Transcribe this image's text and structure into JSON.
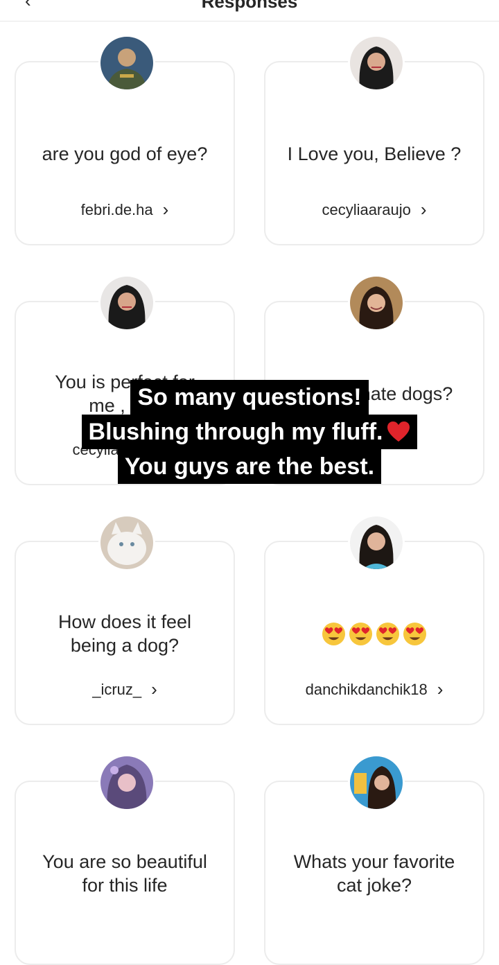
{
  "header": {
    "back_glyph": "‹",
    "title": "Responses"
  },
  "cards": [
    {
      "question": "are you god of eye?",
      "username": "febri.de.ha",
      "avatar": "man-in-uniform"
    },
    {
      "question": "I Love you, Believe ?",
      "username": "cecyliaaraujo",
      "avatar": "woman-dark-hair"
    },
    {
      "question": "You is perfect for\nme , i Lo",
      "username": "cecyliaaraujo",
      "avatar": "woman-dark-hair"
    },
    {
      "question": "Do you hate dogs?",
      "username": "",
      "avatar": "woman-smiling"
    },
    {
      "question": "How does it feel\nbeing a dog?",
      "username": "_icruz_",
      "avatar": "white-cat"
    },
    {
      "emoji": [
        "heart-eyes-emoji",
        "heart-eyes-emoji",
        "heart-eyes-emoji",
        "heart-eyes-emoji"
      ],
      "username": "danchikdanchik18",
      "avatar": "woman-long-hair"
    },
    {
      "question": "You are so beautiful\nfor this life",
      "username": "",
      "avatar": "girl-purple-filter"
    },
    {
      "question": "Whats your favorite\ncat joke?",
      "username": "",
      "avatar": "woman-blue-background"
    }
  ],
  "chevron": "›",
  "overlay": {
    "line1": "So many questions!",
    "line2": "Blushing through my fluff.",
    "line3": "You guys are the best."
  },
  "colors": {
    "border": "#ececec",
    "text": "#262626",
    "overlay_bg": "#000000",
    "heart": "#e0242b"
  }
}
